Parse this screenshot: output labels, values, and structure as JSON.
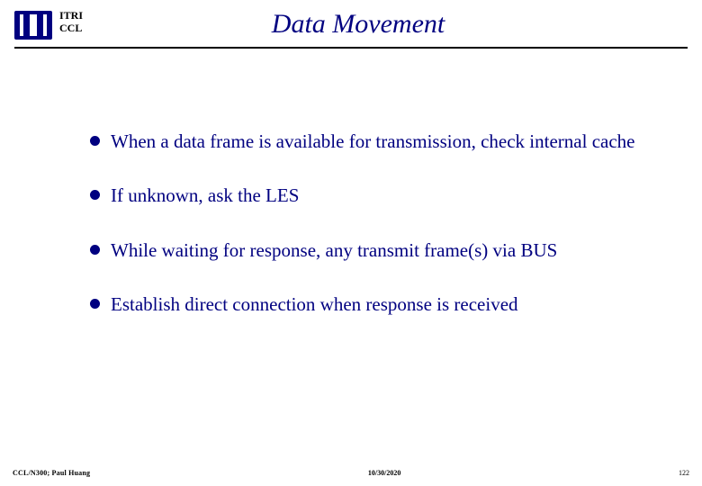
{
  "header": {
    "org_line1": "ITRI",
    "org_line2": "CCL",
    "title": "Data Movement"
  },
  "bullets": [
    "When a data frame is available for transmission, check internal cache",
    "If unknown, ask the LES",
    "While waiting for response, any transmit frame(s) via BUS",
    "Establish direct connection when response is received"
  ],
  "footer": {
    "left": "CCL/N300; Paul Huang",
    "center": "10/30/2020",
    "right": "122"
  }
}
